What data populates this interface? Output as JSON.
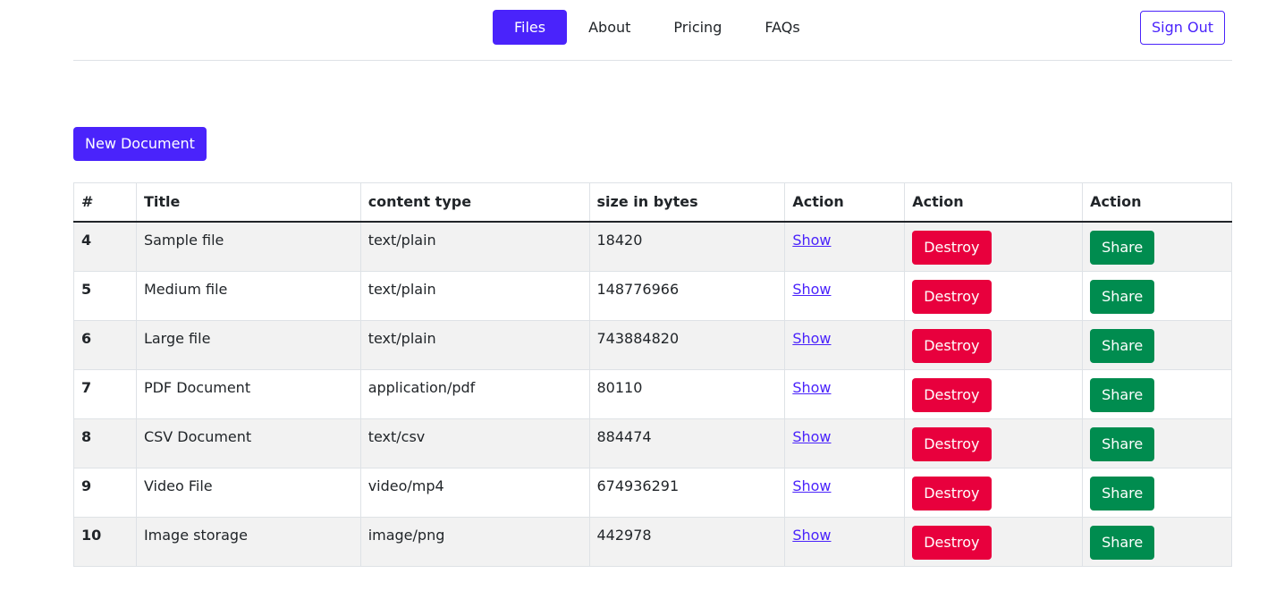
{
  "nav": {
    "items": [
      {
        "label": "Files",
        "active": true
      },
      {
        "label": "About",
        "active": false
      },
      {
        "label": "Pricing",
        "active": false
      },
      {
        "label": "FAQs",
        "active": false
      }
    ],
    "signout_label": "Sign Out"
  },
  "toolbar": {
    "new_document_label": "New Document"
  },
  "table": {
    "headers": [
      "#",
      "Title",
      "content type",
      "size in bytes",
      "Action",
      "Action",
      "Action"
    ],
    "rows": [
      {
        "id": "4",
        "title": "Sample file",
        "content_type": "text/plain",
        "size": "18420",
        "show": "Show",
        "destroy": "Destroy",
        "share": "Share"
      },
      {
        "id": "5",
        "title": "Medium file",
        "content_type": "text/plain",
        "size": "148776966",
        "show": "Show",
        "destroy": "Destroy",
        "share": "Share"
      },
      {
        "id": "6",
        "title": "Large file",
        "content_type": "text/plain",
        "size": "743884820",
        "show": "Show",
        "destroy": "Destroy",
        "share": "Share"
      },
      {
        "id": "7",
        "title": "PDF Document",
        "content_type": "application/pdf",
        "size": "80110",
        "show": "Show",
        "destroy": "Destroy",
        "share": "Share"
      },
      {
        "id": "8",
        "title": "CSV Document",
        "content_type": "text/csv",
        "size": "884474",
        "show": "Show",
        "destroy": "Destroy",
        "share": "Share"
      },
      {
        "id": "9",
        "title": "Video File",
        "content_type": "video/mp4",
        "size": "674936291",
        "show": "Show",
        "destroy": "Destroy",
        "share": "Share"
      },
      {
        "id": "10",
        "title": "Image storage",
        "content_type": "image/png",
        "size": "442978",
        "show": "Show",
        "destroy": "Destroy",
        "share": "Share"
      }
    ]
  },
  "colors": {
    "primary": "#4a23fb",
    "danger": "#e8003d",
    "success": "#008c4f",
    "row_stripe": "#f2f2f2"
  }
}
